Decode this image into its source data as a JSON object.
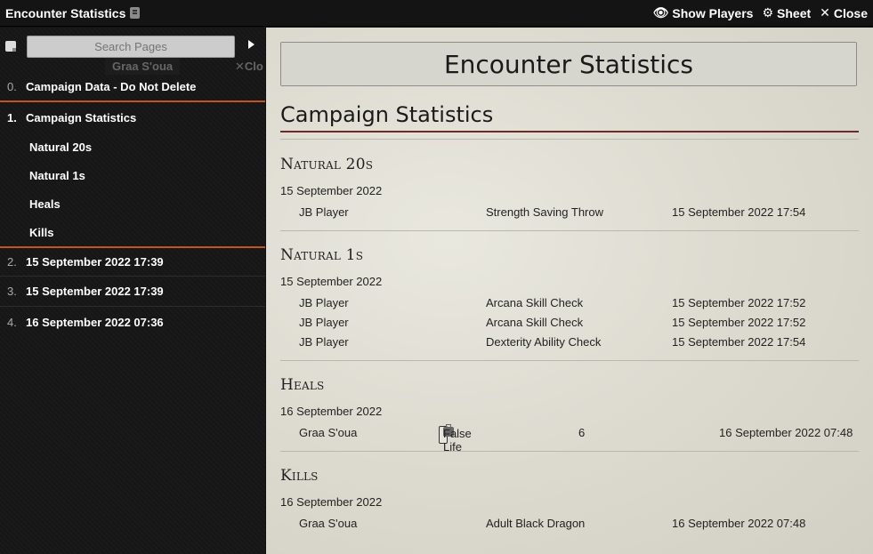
{
  "window": {
    "title": "Encounter Statistics",
    "actions": {
      "show_players": "Show Players",
      "sheet": "Sheet",
      "close": "Close"
    }
  },
  "sidebar": {
    "search_placeholder": "Search Pages",
    "ghost_tab": {
      "title": "Graa S'oua",
      "close": "Clo"
    },
    "items": [
      {
        "num": "0.",
        "label": "Campaign Data - Do Not Delete"
      },
      {
        "num": "1.",
        "label": "Campaign Statistics",
        "children": [
          "Natural 20s",
          "Natural 1s",
          "Heals",
          "Kills"
        ]
      },
      {
        "num": "2.",
        "label": "15 September 2022 17:39"
      },
      {
        "num": "3.",
        "label": "15 September 2022 17:39"
      },
      {
        "num": "4.",
        "label": "16 September 2022 07:36"
      }
    ]
  },
  "main": {
    "header": "Encounter Statistics",
    "section_title": "Campaign Statistics",
    "natural20": {
      "title": "Natural 20s",
      "date": "15 September 2022",
      "rows": [
        {
          "player": "JB Player",
          "check": "Strength Saving Throw",
          "time": "15 September 2022 17:54"
        }
      ]
    },
    "natural1": {
      "title": "Natural 1s",
      "date": "15 September 2022",
      "rows": [
        {
          "player": "JB Player",
          "check": "Arcana Skill Check",
          "time": "15 September 2022 17:52"
        },
        {
          "player": "JB Player",
          "check": "Arcana Skill Check",
          "time": "15 September 2022 17:52"
        },
        {
          "player": "JB Player",
          "check": "Dexterity Ability Check",
          "time": "15 September 2022 17:54"
        }
      ]
    },
    "heals": {
      "title": "Heals",
      "date": "16 September 2022",
      "rows": [
        {
          "player": "Graa S'oua",
          "spell": "False Life",
          "amount": "6",
          "time": "16 September 2022 07:48"
        }
      ]
    },
    "kills": {
      "title": "Kills",
      "date": "16 September 2022",
      "rows": [
        {
          "player": "Graa S'oua",
          "target": "Adult Black Dragon",
          "time": "16 September 2022 07:48"
        }
      ]
    }
  }
}
